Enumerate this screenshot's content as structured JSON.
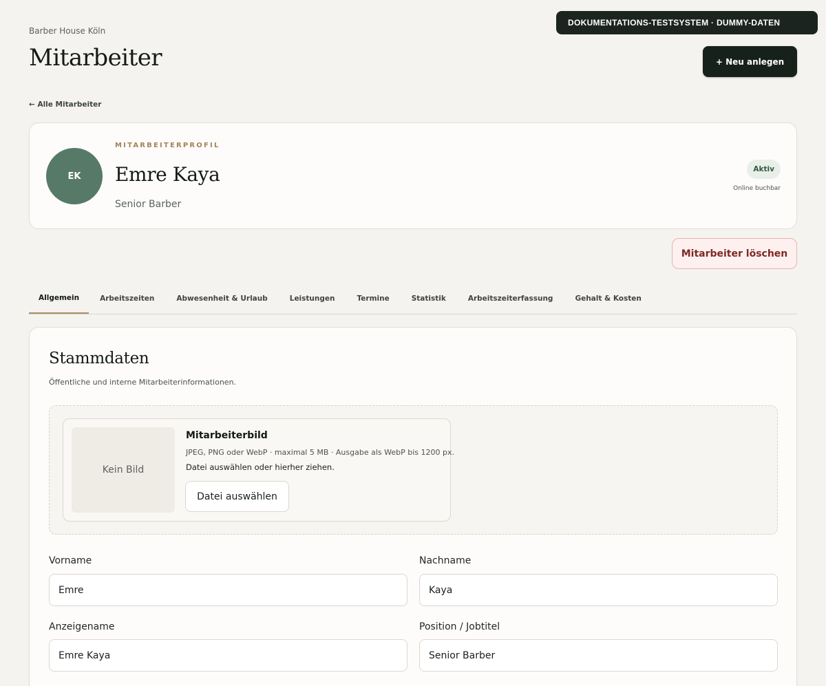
{
  "banner": "DOKUMENTATIONS-TESTSYSTEM · DUMMY-DATEN",
  "header": {
    "studio": "Barber House Köln",
    "title": "Mitarbeiter",
    "new_button": "+ Neu anlegen"
  },
  "back_link": "← Alle Mitarbeiter",
  "profile": {
    "eyebrow": "MITARBEITERPROFIL",
    "initials": "EK",
    "name": "Emre Kaya",
    "role": "Senior Barber",
    "status": "Aktiv",
    "status_sub": "Online buchbar",
    "avatar_color": "#577a68"
  },
  "delete_button": "Mitarbeiter löschen",
  "tabs": [
    {
      "label": "Allgemein",
      "active": true
    },
    {
      "label": "Arbeitszeiten"
    },
    {
      "label": "Abwesenheit & Urlaub"
    },
    {
      "label": "Leistungen"
    },
    {
      "label": "Termine"
    },
    {
      "label": "Statistik"
    },
    {
      "label": "Arbeitszeiterfassung"
    },
    {
      "label": "Gehalt & Kosten"
    }
  ],
  "stammdaten": {
    "title": "Stammdaten",
    "subtitle": "Öffentliche und interne Mitarbeiterinformationen.",
    "image": {
      "placeholder": "Kein Bild",
      "title": "Mitarbeiterbild",
      "hint": "JPEG, PNG oder WebP · maximal 5 MB · Ausgabe als WebP bis 1200 px.",
      "drop": "Datei auswählen oder hierher ziehen.",
      "button": "Datei auswählen"
    },
    "fields": {
      "vorname": {
        "label": "Vorname",
        "value": "Emre"
      },
      "nachname": {
        "label": "Nachname",
        "value": "Kaya"
      },
      "anzeigename": {
        "label": "Anzeigename",
        "value": "Emre Kaya"
      },
      "position": {
        "label": "Position / Jobtitel",
        "value": "Senior Barber"
      }
    }
  },
  "colors": {
    "background": "#f5f3f0",
    "dark": "#17211c",
    "accent": "#a98e68",
    "danger": "#7d2a24"
  }
}
